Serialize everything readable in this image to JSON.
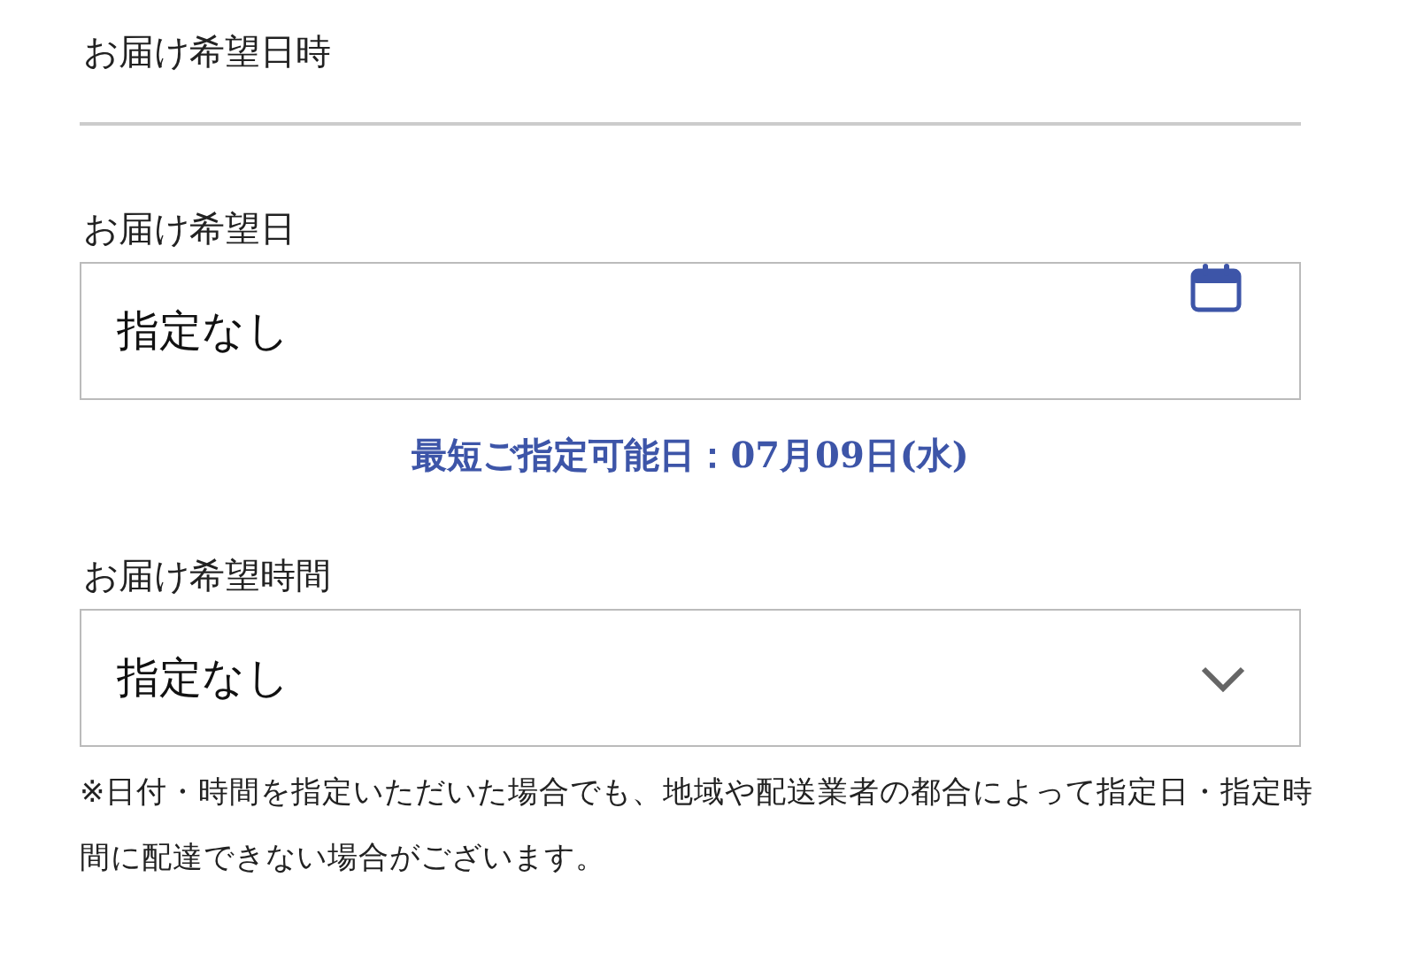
{
  "section_title": "お届け希望日時",
  "date_field": {
    "label": "お届け希望日",
    "value": "指定なし"
  },
  "earliest_date": "最短ご指定可能日：07月09日(水)",
  "time_field": {
    "label": "お届け希望時間",
    "value": "指定なし"
  },
  "note": "※日付・時間を指定いただいた場合でも、地域や配送業者の都合によって指定日・指定時間に配達できない場合がございます。"
}
